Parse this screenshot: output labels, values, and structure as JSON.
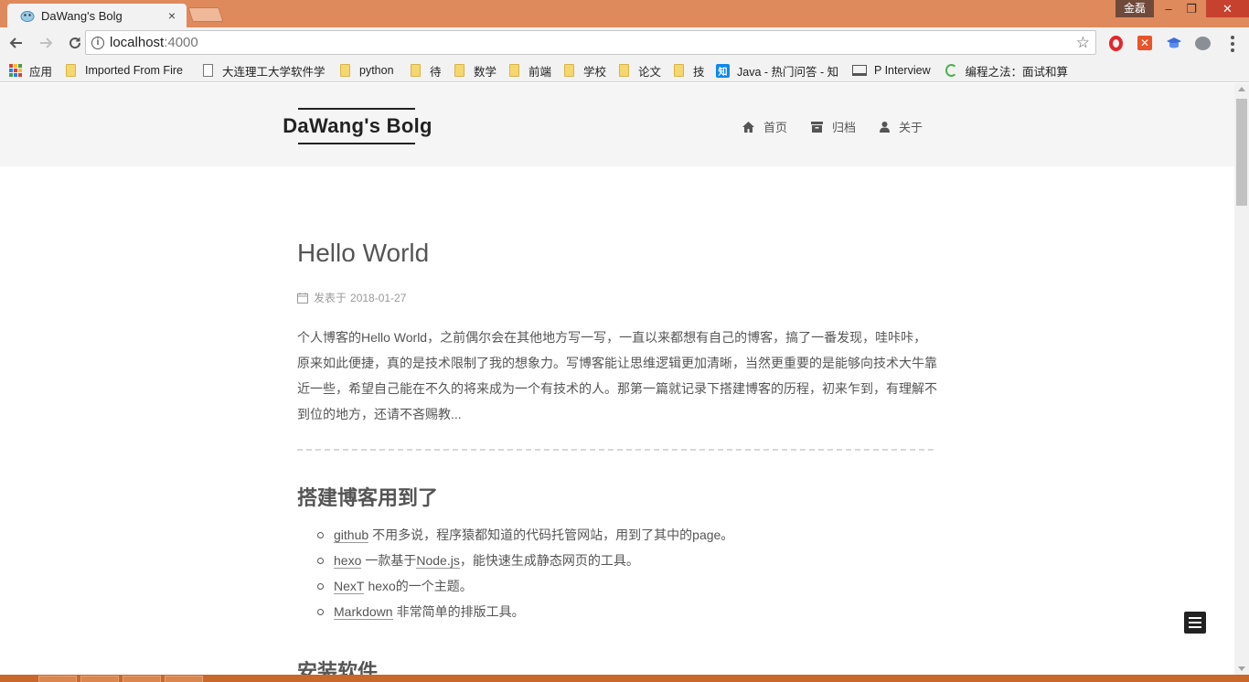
{
  "browser": {
    "tab_title": "DaWang's Bolg",
    "tab_close": "×",
    "user_label": "金磊",
    "window_min": "–",
    "window_max": "❐",
    "window_close": "✕",
    "url_host": "localhost",
    "url_port": ":4000",
    "accent_color": "#df8a5c"
  },
  "bookmarks": [
    {
      "label": "应用",
      "icon": "apps-grid-icon"
    },
    {
      "label": "Imported From Fire",
      "icon": "folder-icon"
    },
    {
      "label": "大连理工大学软件学",
      "icon": "page-icon"
    },
    {
      "label": "python",
      "icon": "folder-icon"
    },
    {
      "label": "待",
      "icon": "folder-icon"
    },
    {
      "label": "数学",
      "icon": "folder-icon"
    },
    {
      "label": "前端",
      "icon": "folder-icon"
    },
    {
      "label": "学校",
      "icon": "folder-icon"
    },
    {
      "label": "论文",
      "icon": "folder-icon"
    },
    {
      "label": "技",
      "icon": "folder-icon"
    },
    {
      "label": "Java - 热门问答 - 知",
      "icon": "zhihu-icon",
      "icon_text": "知"
    },
    {
      "label": "P Interview",
      "icon": "computer-icon"
    },
    {
      "label": "编程之法：面试和算",
      "icon": "swirl-icon"
    }
  ],
  "site": {
    "brand": "DaWang's Bolg",
    "nav": [
      {
        "label": "首页",
        "icon": "home-icon"
      },
      {
        "label": "归档",
        "icon": "archive-icon"
      },
      {
        "label": "关于",
        "icon": "user-icon"
      }
    ]
  },
  "post": {
    "title": "Hello World",
    "meta_label": "发表于",
    "date": "2018-01-27",
    "excerpt_lines": [
      "个人博客的Hello World，之前偶尔会在其他地方写一写，一直以来都想有自己的博客，搞了一番发现，哇咔咔，",
      "原来如此便捷，真的是技术限制了我的想象力。写博客能让思维逻辑更加清晰，当然更重要的是能够向技术大牛靠",
      "近一些，希望自己能在不久的将来成为一个有技术的人。那第一篇就记录下搭建博客的历程，初来乍到，有理解不",
      "到位的地方，还请不吝赐教..."
    ],
    "section1_heading": "搭建博客用到了",
    "tools": [
      {
        "link": "github",
        "text": "不用多说，程序猿都知道的代码托管网站，用到了其中的page。"
      },
      {
        "link": "hexo",
        "text": "一款基于",
        "link2": "Node.js",
        "text2": "，能快速生成静态网页的工具。"
      },
      {
        "link": "NexT",
        "text": "hexo的一个主题。"
      },
      {
        "link": "Markdown",
        "text": "非常简单的排版工具。"
      }
    ],
    "section2_heading": "安装软件"
  }
}
